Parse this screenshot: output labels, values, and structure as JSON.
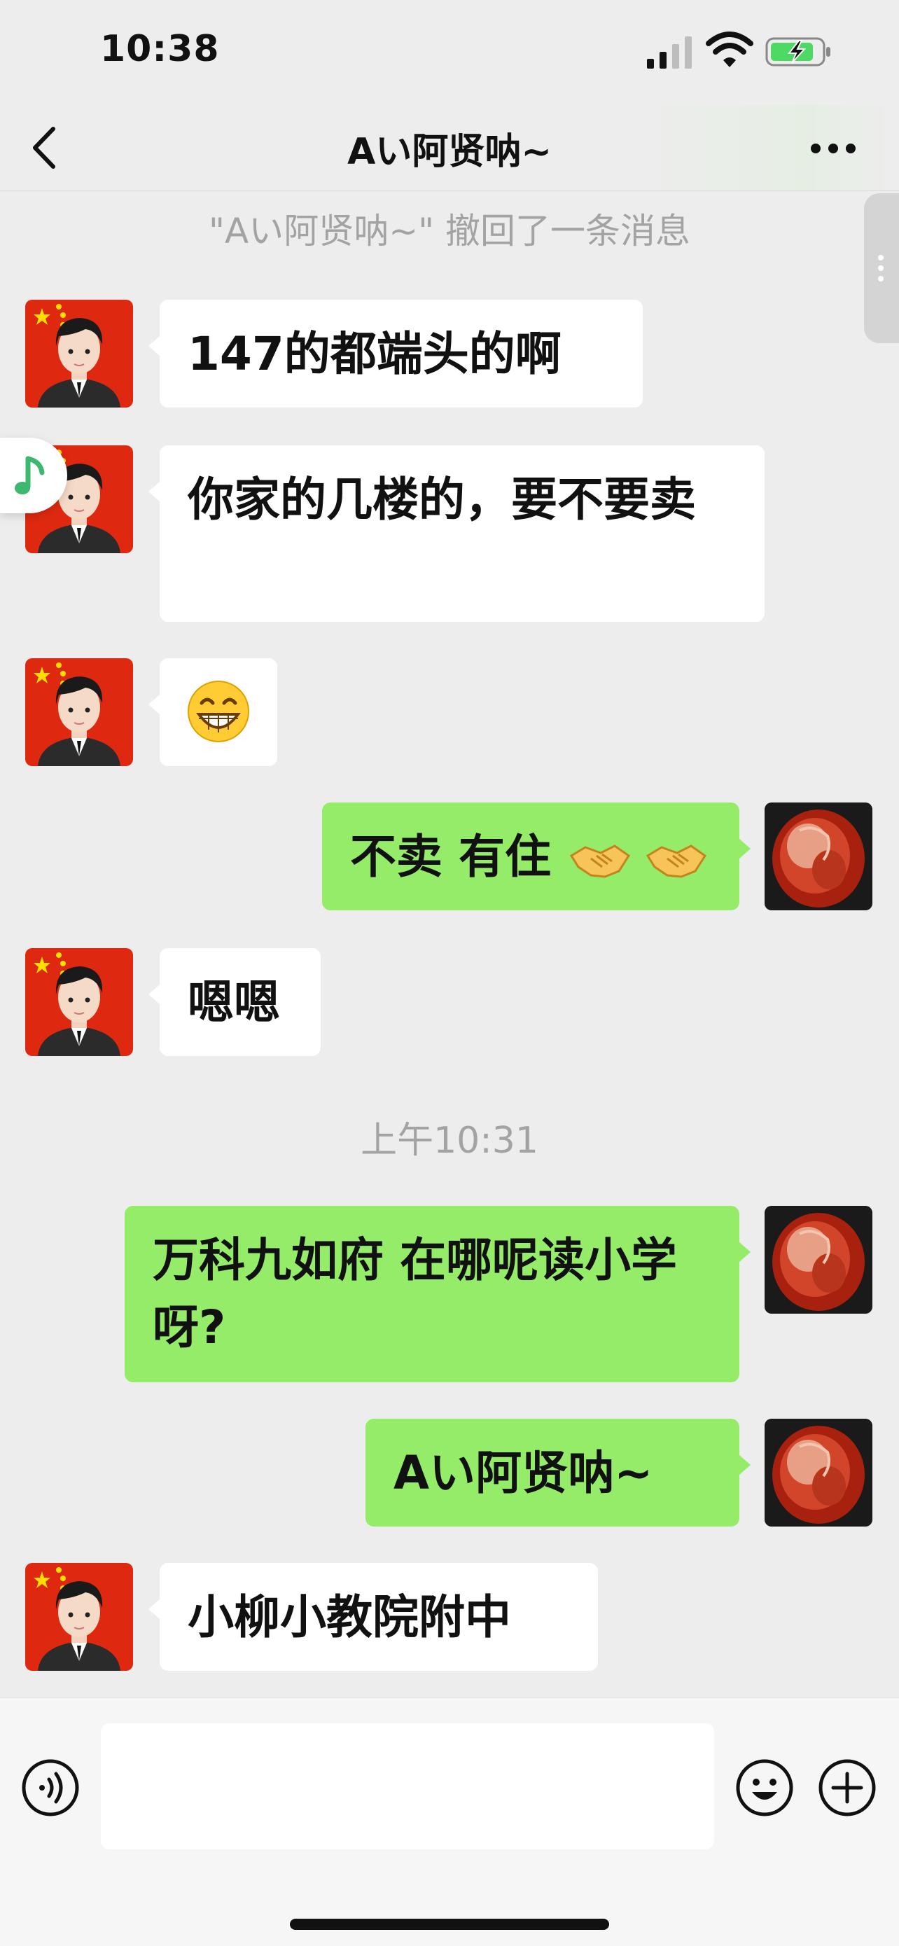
{
  "status": {
    "time": "10:38"
  },
  "nav": {
    "title": "Aい阿贤呐~"
  },
  "recall_notice": "\"Aい阿贤呐~\" 撤回了一条消息",
  "timestamp": "上午10:31",
  "messages": [
    {
      "side": "in",
      "text": "147的都端头的啊"
    },
    {
      "side": "in",
      "text": "你家的几楼的，要不要卖"
    },
    {
      "side": "in",
      "text": "grinning-face-emoji"
    },
    {
      "side": "out",
      "text": "不卖 有住",
      "emojis": [
        "handshake-emoji",
        "handshake-emoji"
      ]
    },
    {
      "side": "in",
      "text": "嗯嗯"
    },
    {
      "side": "out",
      "text": "万科九如府 在哪呢读小学呀?"
    },
    {
      "side": "out",
      "text": "Aい阿贤呐~"
    },
    {
      "side": "in",
      "text": "小柳小教院附中"
    }
  ],
  "colors": {
    "out_bubble": "#95ec69",
    "in_bubble": "#ffffff",
    "background": "#ededed"
  }
}
